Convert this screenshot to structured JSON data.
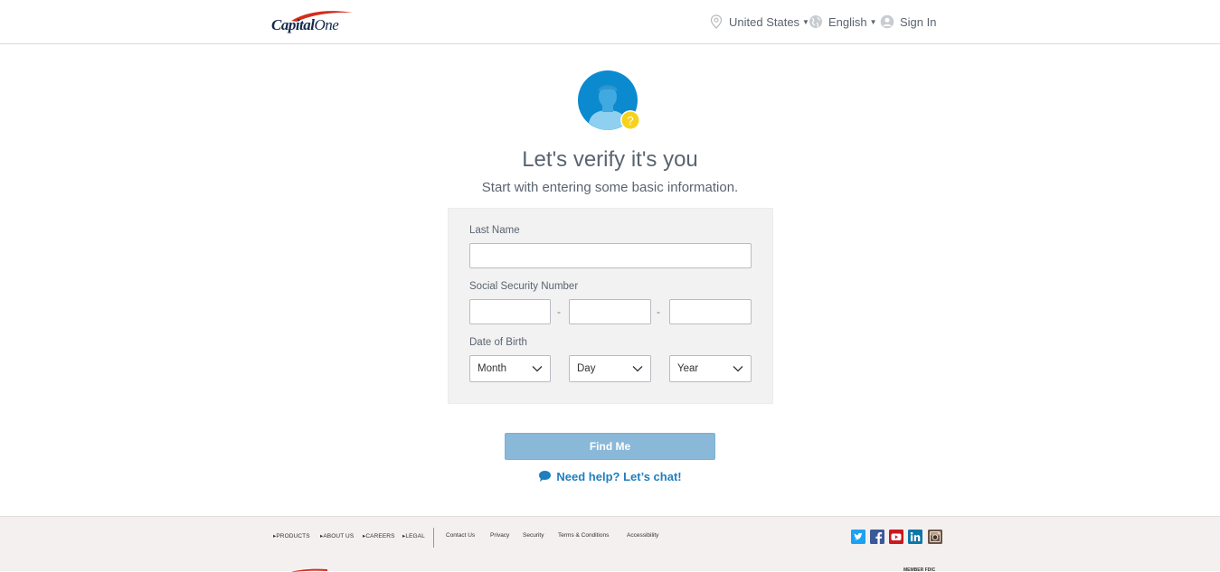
{
  "header": {
    "logo_word": "Capital",
    "logo_word2": "One",
    "country": "United States",
    "language": "English",
    "sign_in": "Sign In"
  },
  "main": {
    "title": "Let's verify it's you",
    "subtitle": "Start with entering some basic information.",
    "form": {
      "last_name_label": "Last Name",
      "last_name_value": "",
      "ssn_label": "Social Security Number",
      "ssn_separator": "-",
      "ssn_values": [
        "",
        "",
        ""
      ],
      "dob_label": "Date of Birth",
      "month": "Month",
      "day": "Day",
      "year": "Year"
    },
    "find_button": "Find Me",
    "chat_link": "Need help? Let’s chat!"
  },
  "footer": {
    "nav": [
      "PRODUCTS",
      "ABOUT US",
      "CAREERS",
      "LEGAL"
    ],
    "links": [
      "Contact Us",
      "Privacy",
      "Security",
      "Terms & Conditions",
      "Accessibility"
    ],
    "social": [
      "twitter-icon",
      "facebook-icon",
      "youtube-icon",
      "linkedin-icon",
      "instagram-icon"
    ],
    "member": "MEMBER FDIC"
  },
  "colors": {
    "accent_blue": "#1f7fbf",
    "button_disabled": "#89b8d8",
    "panel_bg": "#f2f2f2",
    "logo_navy": "#13294b",
    "logo_red": "#d22e1e"
  }
}
